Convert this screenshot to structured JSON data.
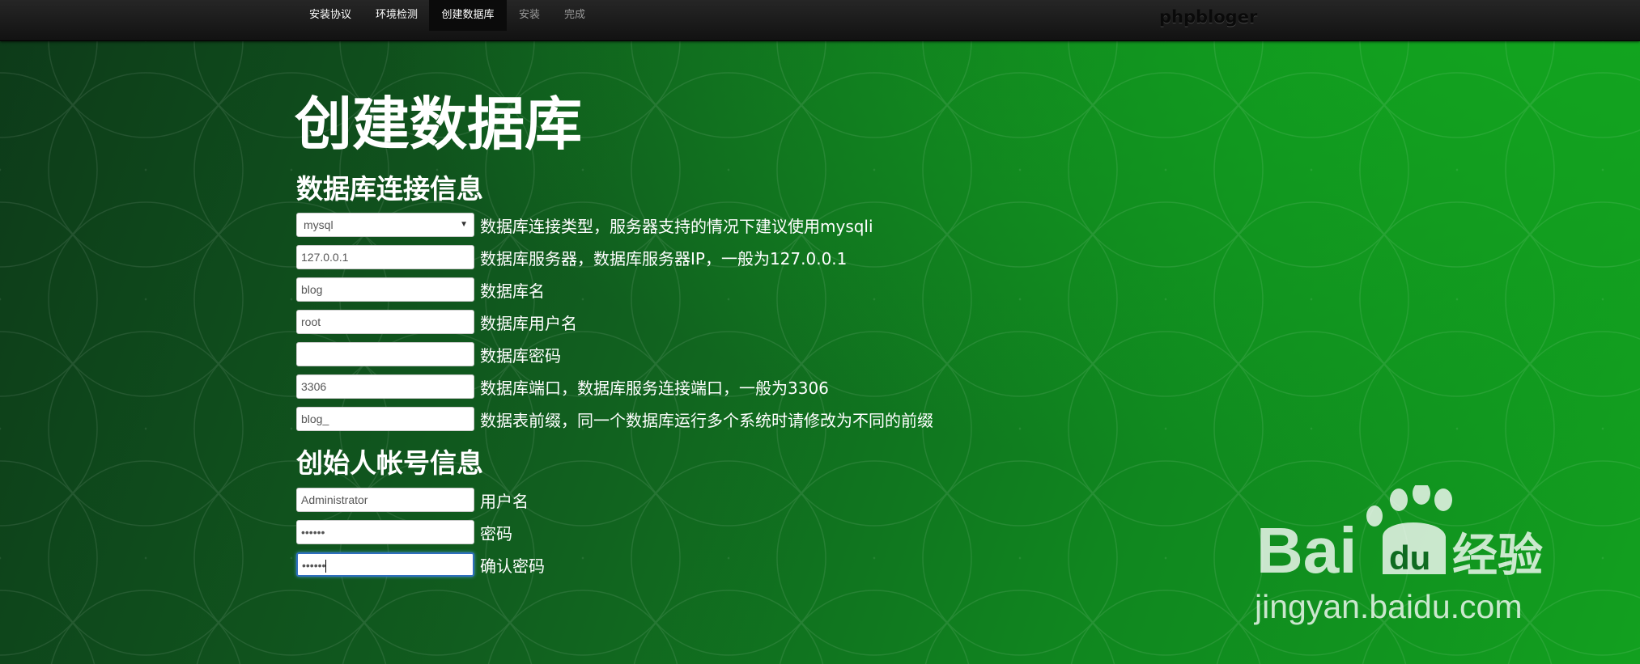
{
  "nav": {
    "steps": [
      {
        "label": "安装协议",
        "state": "done"
      },
      {
        "label": "环境检测",
        "state": "done"
      },
      {
        "label": "创建数据库",
        "state": "current"
      },
      {
        "label": "安装",
        "state": "todo"
      },
      {
        "label": "完成",
        "state": "todo"
      }
    ],
    "brand": "phpbloger"
  },
  "page_title": "创建数据库",
  "db_section": {
    "title": "数据库连接信息",
    "fields": [
      {
        "type": "select",
        "value": "mysql",
        "hint": "数据库连接类型，服务器支持的情况下建议使用mysqli"
      },
      {
        "type": "text",
        "value": "127.0.0.1",
        "hint": "数据库服务器，数据库服务器IP，一般为127.0.0.1"
      },
      {
        "type": "text",
        "value": "blog",
        "hint": "数据库名"
      },
      {
        "type": "text",
        "value": "root",
        "hint": "数据库用户名"
      },
      {
        "type": "password",
        "value": "",
        "hint": "数据库密码"
      },
      {
        "type": "text",
        "value": "3306",
        "hint": "数据库端口，数据库服务连接端口，一般为3306"
      },
      {
        "type": "text",
        "value": "blog_",
        "hint": "数据表前缀，同一个数据库运行多个系统时请修改为不同的前缀"
      }
    ]
  },
  "admin_section": {
    "title": "创始人帐号信息",
    "fields": [
      {
        "type": "text",
        "value": "Administrator",
        "hint": "用户名"
      },
      {
        "type": "password",
        "value": "••••••",
        "hint": "密码"
      },
      {
        "type": "password",
        "value": "••••••",
        "hint": "确认密码"
      }
    ]
  },
  "watermark": {
    "logo_text": "Bai",
    "logo_paw_text": "du",
    "logo_cn": "经验",
    "url": "jingyan.baidu.com"
  },
  "colors": {
    "accent_green": "#12a01f",
    "nav_bg": "#1a1a1a",
    "focus_border": "#2f6fbf"
  }
}
